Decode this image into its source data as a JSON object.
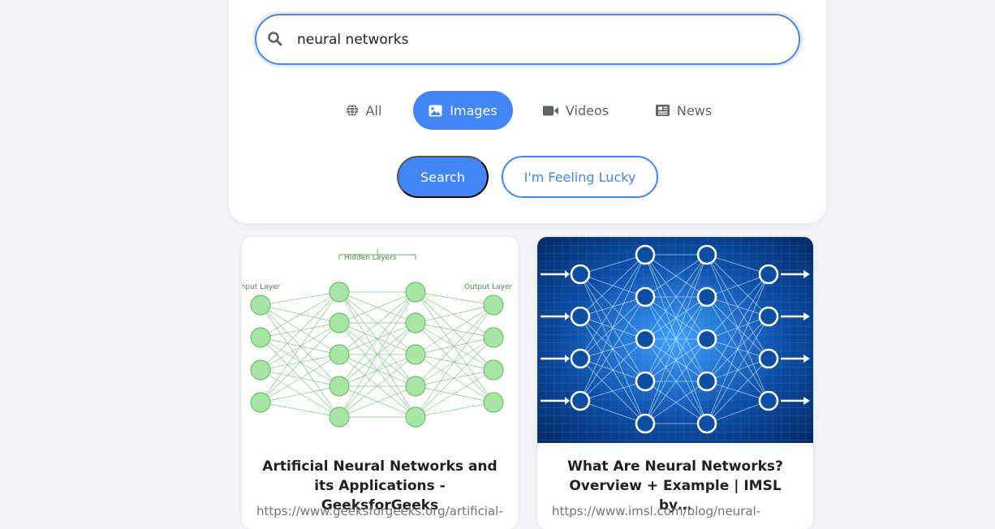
{
  "search": {
    "query": "neural networks"
  },
  "tabs": [
    {
      "label": "All",
      "icon": "globe-icon",
      "active": false
    },
    {
      "label": "Images",
      "icon": "image-icon",
      "active": true
    },
    {
      "label": "Videos",
      "icon": "video-camera-icon",
      "active": false
    },
    {
      "label": "News",
      "icon": "newspaper-icon",
      "active": false
    }
  ],
  "buttons": {
    "search_label": "Search",
    "lucky_label": "I'm Feeling Lucky"
  },
  "results": [
    {
      "title": "Artificial Neural Networks and its Applications - GeeksforGeeks",
      "url": "https://www.geeksforgeeks.org/artificial-",
      "image": "neural-network-diagram-green",
      "image_labels": {
        "hidden": "Hidden Layers",
        "input": "Input Layer",
        "output": "Output Layer"
      }
    },
    {
      "title": "What Are Neural Networks? Overview + Example | IMSL by…",
      "url": "https://www.imsl.com/blog/neural-",
      "image": "neural-network-glowing-blue"
    }
  ],
  "colors": {
    "accent": "#4285f4",
    "search_border": "#4a86e8",
    "background": "#f3f4f7",
    "diagram_green": "#a8e6a8"
  }
}
